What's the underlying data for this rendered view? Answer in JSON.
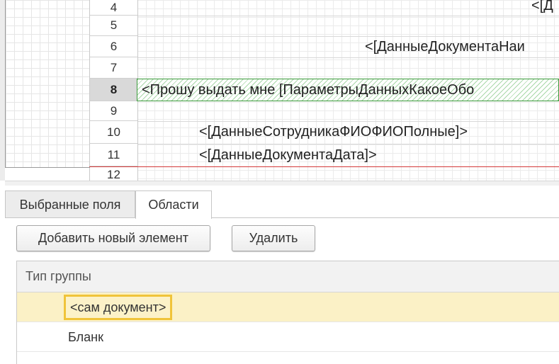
{
  "sheet": {
    "row_numbers": [
      "4",
      "5",
      "6",
      "7",
      "8",
      "9",
      "10",
      "11",
      "12"
    ],
    "selected_row": "8",
    "cells": {
      "row4": "<[Д",
      "row6": "<[ДанныеДокументаНаи",
      "row8": "<Прошу выдать мне  [ПараметрыДанныхКакоеОбо",
      "row10": "<[ДанныеСотрудникаФИОФИОПолные]>",
      "row11": "<[ДанныеДокументаДата]>"
    }
  },
  "tabs": [
    {
      "label": "Выбранные поля",
      "active": false
    },
    {
      "label": "Области",
      "active": true
    }
  ],
  "toolbar": {
    "add_label": "Добавить новый элемент",
    "delete_label": "Удалить"
  },
  "table": {
    "header": "Тип группы",
    "rows": [
      {
        "value": "<сам документ>",
        "selected": true
      },
      {
        "value": "Бланк",
        "selected": false
      }
    ]
  },
  "colors": {
    "selection_fill": "#fbf1c6",
    "selection_border": "#f0c43a",
    "area_border": "#3c9a3c",
    "area_hatch": "#a9d8a9",
    "boundary_line": "#d43a3a"
  }
}
